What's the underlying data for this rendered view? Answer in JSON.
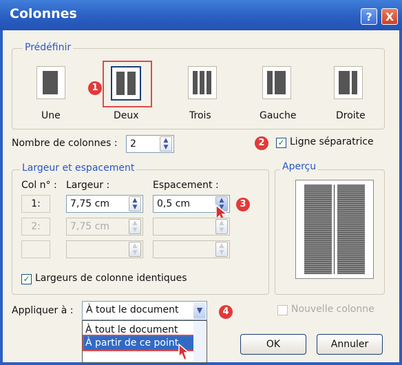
{
  "window": {
    "title": "Colonnes",
    "help_button": "?",
    "close_button": "X"
  },
  "predefined": {
    "group_label": "Prédéfinir",
    "presets": [
      {
        "label": "Une"
      },
      {
        "label": "Deux"
      },
      {
        "label": "Trois"
      },
      {
        "label": "Gauche"
      },
      {
        "label": "Droite"
      }
    ]
  },
  "badges": [
    "1",
    "2",
    "3",
    "4"
  ],
  "num_columns": {
    "label": "Nombre de colonnes :",
    "value": "2"
  },
  "separator": {
    "label": "Ligne séparatrice",
    "checked": true
  },
  "width_spacing": {
    "group_label": "Largeur et espacement",
    "col_header": "Col n° :",
    "width_header": "Largeur :",
    "spacing_header": "Espacement :",
    "rows": [
      {
        "col": "1:",
        "width": "7,75 cm",
        "spacing": "0,5 cm"
      },
      {
        "col": "2:",
        "width": "7,75 cm",
        "spacing": ""
      },
      {
        "col": "",
        "width": "",
        "spacing": ""
      }
    ],
    "equal_widths": {
      "label": "Largeurs de colonne identiques",
      "checked": true
    }
  },
  "preview": {
    "group_label": "Aperçu"
  },
  "apply": {
    "label": "Appliquer à :",
    "value": "À tout le document",
    "options": [
      "À tout le document",
      "À partir de ce point"
    ]
  },
  "new_column": {
    "label": "Nouvelle colonne",
    "checked": false
  },
  "buttons": {
    "ok": "OK",
    "cancel": "Annuler"
  },
  "colors": {
    "title_bar": "#2a5fc2",
    "group_label": "#2a55c7",
    "badge": "#e23a3a",
    "selection": "#316ac5"
  }
}
